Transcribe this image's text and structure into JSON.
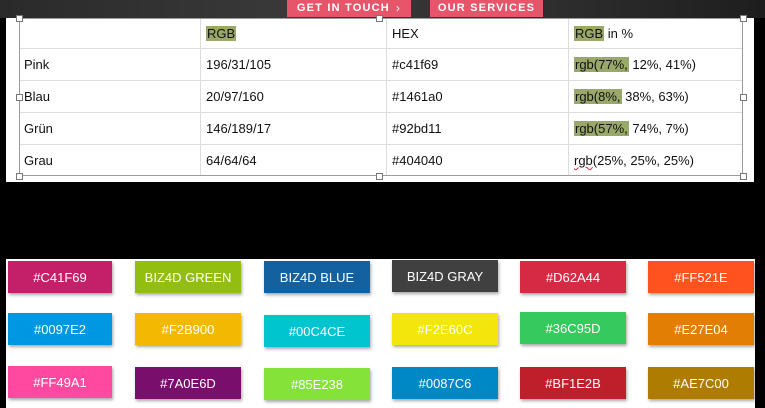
{
  "top_buttons": {
    "get_in_touch": "GET IN TOUCH",
    "our_services": "OUR SERVICES",
    "chevron": "›"
  },
  "table": {
    "header": [
      "",
      "RGB",
      "HEX",
      "RGB in %"
    ],
    "header_pct_rest": " in %",
    "rows": [
      {
        "name": "Pink",
        "rgb": "196/31/105",
        "hex": "#c41f69",
        "pct_hl": "rgb(77%,",
        "pct_rest": " 12%, 41%)"
      },
      {
        "name": "Blau",
        "rgb": "20/97/160",
        "hex": "#1461a0",
        "pct_hl": "rgb(8%,",
        "pct_rest": " 38%, 63%)"
      },
      {
        "name": "Grün",
        "rgb": "146/189/17",
        "hex": "#92bd11",
        "pct_hl": "rgb(57%,",
        "pct_rest": " 74%, 7%)"
      },
      {
        "name": "Grau",
        "rgb": "64/64/64",
        "hex": "#404040",
        "pct_hl": "rgb",
        "pct_rest": "(25%, 25%, 25%)"
      }
    ]
  },
  "swatches": [
    [
      {
        "label": "#C41F69",
        "color": "#c41f69",
        "text": "#ffffff"
      },
      {
        "label": "BIZ4D GREEN",
        "color": "#92bd11",
        "text": "#ffffff"
      },
      {
        "label": "BIZ4D BLUE",
        "color": "#1461a0",
        "text": "#ffffff"
      },
      {
        "label": "BIZ4D GRAY",
        "color": "#404040",
        "text": "#ffffff"
      },
      {
        "label": "#D62A44",
        "color": "#d62a44",
        "text": "#ffffff"
      },
      {
        "label": "#FF521E",
        "color": "#ff521e",
        "text": "#ffffff"
      }
    ],
    [
      {
        "label": "#0097E2",
        "color": "#0097e2",
        "text": "#ffffff"
      },
      {
        "label": "#F2B900",
        "color": "#f2b900",
        "text": "#ffffff"
      },
      {
        "label": "#00C4CE",
        "color": "#00c4ce",
        "text": "#ffffff"
      },
      {
        "label": "#F2E60C",
        "color": "#f2e60c",
        "text": "#ffffff"
      },
      {
        "label": "#36C95D",
        "color": "#36c95d",
        "text": "#ffffff"
      },
      {
        "label": "#E27E04",
        "color": "#e27e04",
        "text": "#ffffff"
      }
    ],
    [
      {
        "label": "#FF49A1",
        "color": "#ff49a1",
        "text": "#ffffff"
      },
      {
        "label": "#7A0E6D",
        "color": "#7a0e6d",
        "text": "#ffffff"
      },
      {
        "label": "#85E238",
        "color": "#85e238",
        "text": "#ffffff"
      },
      {
        "label": "#0087C6",
        "color": "#0087c6",
        "text": "#ffffff"
      },
      {
        "label": "#BF1E2B",
        "color": "#bf1e2b",
        "text": "#ffffff"
      },
      {
        "label": "#AE7C00",
        "color": "#ae7c00",
        "text": "#ffffff"
      }
    ]
  ]
}
